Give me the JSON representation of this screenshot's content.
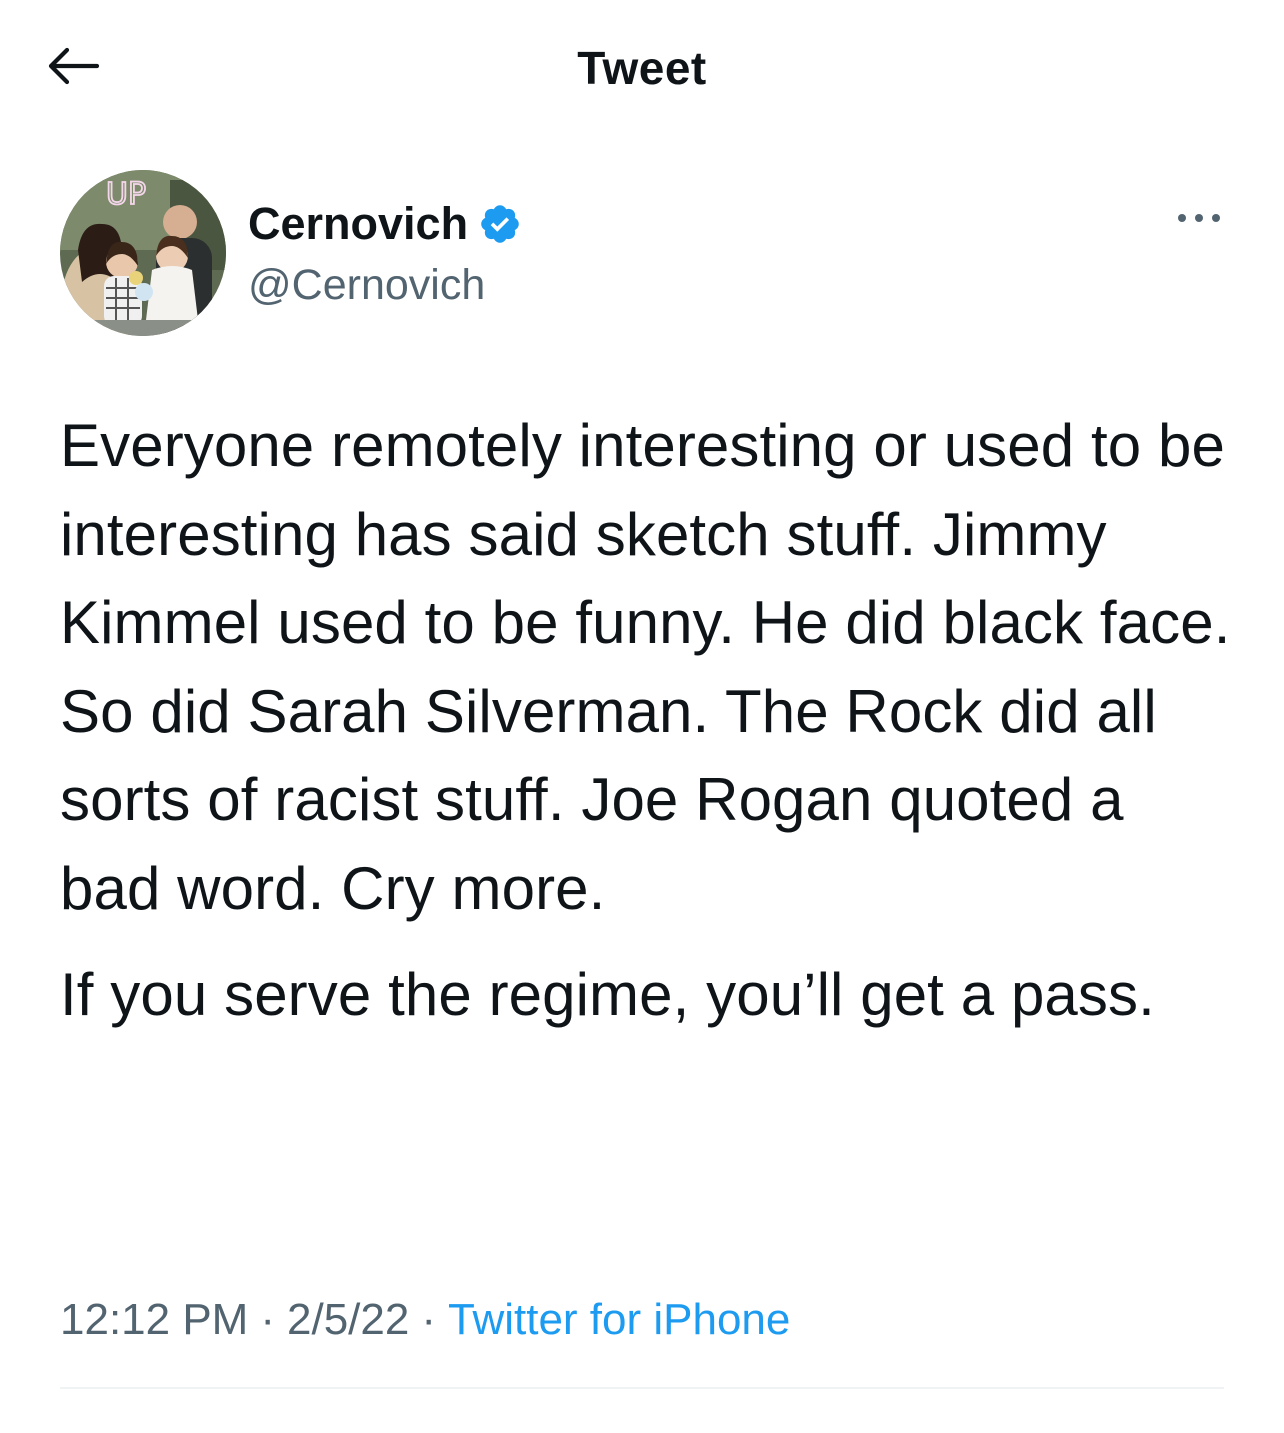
{
  "header": {
    "title": "Tweet",
    "back_icon": "arrow-left-icon"
  },
  "author": {
    "display_name": "Cernovich",
    "handle": "@Cernovich",
    "verified": true,
    "verified_icon": "verified-badge-icon",
    "avatar_sign_text": "UP",
    "more_icon": "more-horizontal-icon"
  },
  "tweet": {
    "paragraphs": [
      "Everyone remotely interesting or used to be interesting has said sketch stuff. Jimmy Kimmel used to be funny. He did black face. So did Sarah Silverman. The Rock did all sorts of racist stuff. Joe Rogan quoted a bad word. Cry more.",
      "If you serve the regime, you’ll get a pass."
    ],
    "time": "12:12 PM",
    "date": "2/5/22",
    "separator": "·",
    "source": "Twitter for iPhone"
  },
  "colors": {
    "text_primary": "#0f1419",
    "text_secondary": "#536471",
    "accent": "#1d9bf0",
    "divider": "#eff3f4"
  }
}
